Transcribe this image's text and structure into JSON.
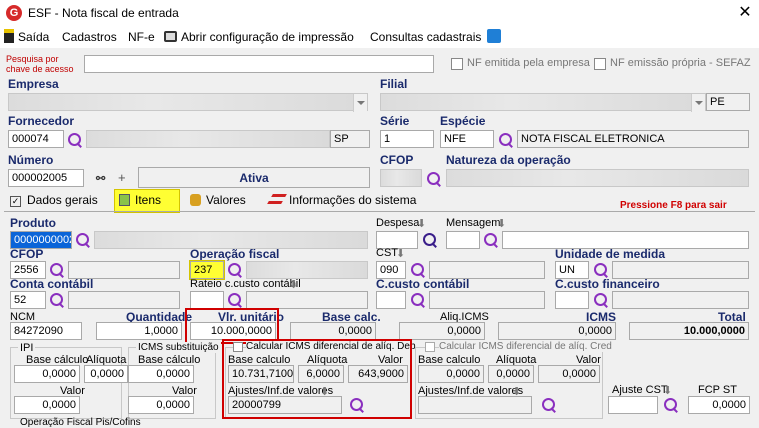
{
  "window": {
    "title": "ESF - Nota fiscal de entrada",
    "logo": "G",
    "close": "✕"
  },
  "menu": {
    "saida": "Saída",
    "cadastros": "Cadastros",
    "nfe": "NF-e",
    "abrir_config": "Abrir configuração de impressão",
    "consultas": "Consultas cadastrais"
  },
  "search": {
    "label": "Pesquisa por chave de acesso",
    "value": "",
    "nf_emitida": "NF emitida pela empresa",
    "nf_propria": "NF emissão própria - SEFAZ"
  },
  "empresa": {
    "label": "Empresa",
    "value": "",
    "filial_label": "Filial",
    "filial_value": "",
    "filial_uf": "PE"
  },
  "fornecedor": {
    "label": "Fornecedor",
    "code": "000074",
    "name": "",
    "uf": "SP",
    "serie_label": "Série",
    "serie": "1",
    "especie_label": "Espécie",
    "especie": "NFE",
    "especie_desc": "NOTA FISCAL ELETRONICA"
  },
  "numero": {
    "label": "Número",
    "value": "000002005",
    "status": "Ativa",
    "cfop_label": "CFOP",
    "cfop": "",
    "natureza_label": "Natureza da operação",
    "natureza": ""
  },
  "tabs": {
    "dados_gerais": "Dados gerais",
    "itens": "Itens",
    "valores": "Valores",
    "info": "Informações do sistema",
    "f8": "Pressione F8 para sair"
  },
  "item": {
    "produto_label": "Produto",
    "produto": "0000000002",
    "produto_desc": "",
    "despesa_label": "Despesa",
    "mensagem_label": "Mensagem",
    "cfop_label": "CFOP",
    "cfop": "2556",
    "cfop_desc": "",
    "operacao_label": "Operação fiscal",
    "operacao": "237",
    "operacao_desc": "",
    "cst_label": "CST",
    "cst": "090",
    "cst_desc": "",
    "unidade_label": "Unidade de medida",
    "unidade": "UN",
    "unidade_desc": "",
    "conta_label": "Conta contábil",
    "conta": "52",
    "conta_desc": "",
    "rateio_label": "Rateio c.custo contábil",
    "ccusto_label": "C.custo contábil",
    "ccusto_fin_label": "C.custo financeiro",
    "ncm_label": "NCM",
    "ncm": "84272090",
    "quantidade_label": "Quantidade",
    "quantidade": "1,0000",
    "vlr_unit_label": "Vlr. unitário",
    "vlr_unit": "10.000,0000",
    "base_calc_label": "Base calc.",
    "base_calc": "0,0000",
    "aliq_icms_label": "Aliq.ICMS",
    "aliq_icms": "0,0000",
    "icms_label": "ICMS",
    "icms": "0,0000",
    "total_label": "Total",
    "total": "10.000,0000"
  },
  "ipi": {
    "title": "IPI",
    "base_label": "Base cálculo",
    "aliq_label": "Alíquota",
    "base": "0,0000",
    "aliq": "0,0000",
    "valor_label": "Valor",
    "valor": "0,0000"
  },
  "icms_st": {
    "title": "ICMS substituição",
    "base_label": "Base cálculo",
    "base": "0,0000",
    "valor_label": "Valor",
    "valor": "0,0000"
  },
  "difal_deb": {
    "title": "Calcular ICMS diferencial de alíq. Deb",
    "base_label": "Base calculo",
    "aliq_label": "Alíquota",
    "valor_label": "Valor",
    "base": "10.731,7100",
    "aliq": "6,0000",
    "valor": "643,9000",
    "ajustes_label": "Ajustes/Inf.de valores",
    "ajustes": "20000799"
  },
  "difal_cred": {
    "title": "Calcular ICMS diferencial de alíq. Cred",
    "base_label": "Base calculo",
    "aliq_label": "Alíquota",
    "valor_label": "Valor",
    "base": "0,0000",
    "aliq": "0,0000",
    "valor": "0,0000",
    "ajustes_label": "Ajustes/Inf.de valores",
    "ajustes": ""
  },
  "ajuste_cst": {
    "label": "Ajuste CST",
    "value": ""
  },
  "fcp_st": {
    "label": "FCP ST",
    "value": "0,0000"
  },
  "footer": {
    "operacao_pis": "Operação Fiscal Pis/Cofins"
  }
}
